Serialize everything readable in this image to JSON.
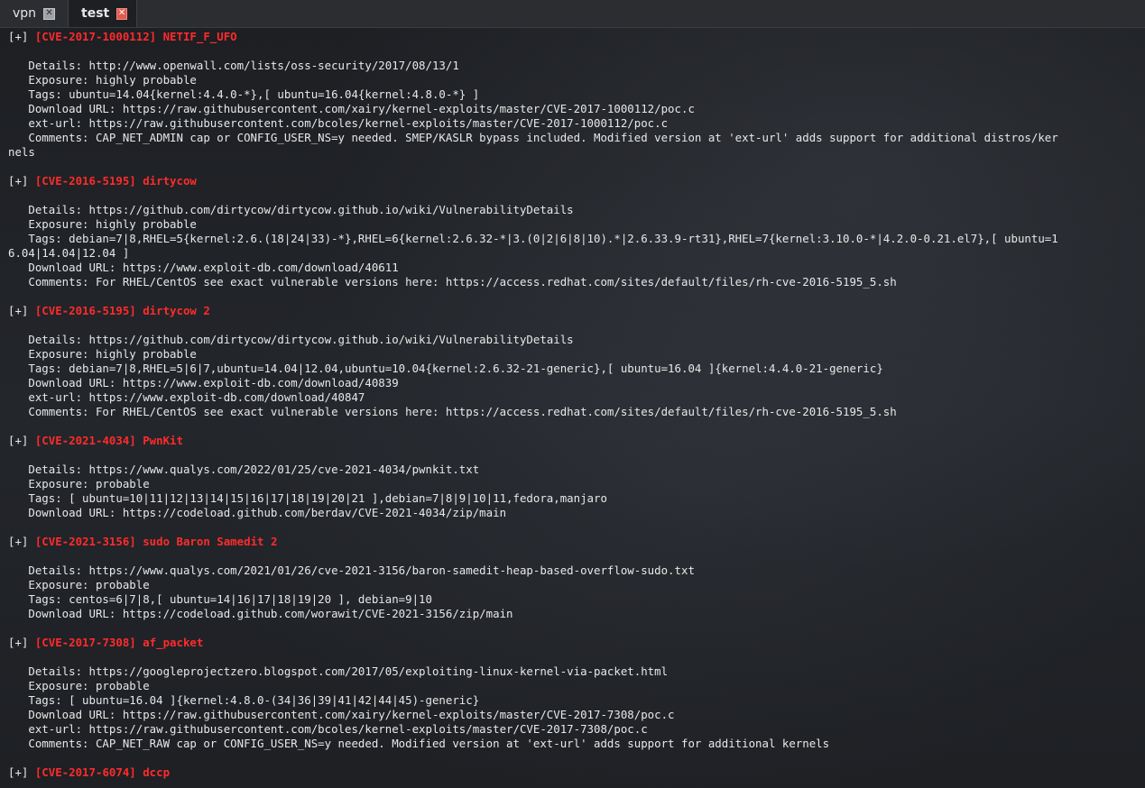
{
  "tabs": [
    {
      "label": "vpn",
      "active": false
    },
    {
      "label": "test",
      "active": true
    }
  ],
  "entries": [
    {
      "marker": "[+] ",
      "cve": "[CVE-2017-1000112]",
      "name": " NETIF_F_UFO",
      "lines": [
        "   Details: http://www.openwall.com/lists/oss-security/2017/08/13/1",
        "   Exposure: highly probable",
        "   Tags: ubuntu=14.04{kernel:4.4.0-*},[ ubuntu=16.04{kernel:4.8.0-*} ]",
        "   Download URL: https://raw.githubusercontent.com/xairy/kernel-exploits/master/CVE-2017-1000112/poc.c",
        "   ext-url: https://raw.githubusercontent.com/bcoles/kernel-exploits/master/CVE-2017-1000112/poc.c",
        "   Comments: CAP_NET_ADMIN cap or CONFIG_USER_NS=y needed. SMEP/KASLR bypass included. Modified version at 'ext-url' adds support for additional distros/ker",
        "nels"
      ]
    },
    {
      "marker": "[+] ",
      "cve": "[CVE-2016-5195]",
      "name": " dirtycow",
      "lines": [
        "   Details: https://github.com/dirtycow/dirtycow.github.io/wiki/VulnerabilityDetails",
        "   Exposure: highly probable",
        "   Tags: debian=7|8,RHEL=5{kernel:2.6.(18|24|33)-*},RHEL=6{kernel:2.6.32-*|3.(0|2|6|8|10).*|2.6.33.9-rt31},RHEL=7{kernel:3.10.0-*|4.2.0-0.21.el7},[ ubuntu=1",
        "6.04|14.04|12.04 ]",
        "   Download URL: https://www.exploit-db.com/download/40611",
        "   Comments: For RHEL/CentOS see exact vulnerable versions here: https://access.redhat.com/sites/default/files/rh-cve-2016-5195_5.sh"
      ]
    },
    {
      "marker": "[+] ",
      "cve": "[CVE-2016-5195]",
      "name": " dirtycow 2",
      "lines": [
        "   Details: https://github.com/dirtycow/dirtycow.github.io/wiki/VulnerabilityDetails",
        "   Exposure: highly probable",
        "   Tags: debian=7|8,RHEL=5|6|7,ubuntu=14.04|12.04,ubuntu=10.04{kernel:2.6.32-21-generic},[ ubuntu=16.04 ]{kernel:4.4.0-21-generic}",
        "   Download URL: https://www.exploit-db.com/download/40839",
        "   ext-url: https://www.exploit-db.com/download/40847",
        "   Comments: For RHEL/CentOS see exact vulnerable versions here: https://access.redhat.com/sites/default/files/rh-cve-2016-5195_5.sh"
      ]
    },
    {
      "marker": "[+] ",
      "cve": "[CVE-2021-4034]",
      "name": " PwnKit",
      "lines": [
        "   Details: https://www.qualys.com/2022/01/25/cve-2021-4034/pwnkit.txt",
        "   Exposure: probable",
        "   Tags: [ ubuntu=10|11|12|13|14|15|16|17|18|19|20|21 ],debian=7|8|9|10|11,fedora,manjaro",
        "   Download URL: https://codeload.github.com/berdav/CVE-2021-4034/zip/main"
      ]
    },
    {
      "marker": "[+] ",
      "cve": "[CVE-2021-3156]",
      "name": " sudo Baron Samedit 2",
      "lines": [
        "   Details: https://www.qualys.com/2021/01/26/cve-2021-3156/baron-samedit-heap-based-overflow-sudo.txt",
        "   Exposure: probable",
        "   Tags: centos=6|7|8,[ ubuntu=14|16|17|18|19|20 ], debian=9|10",
        "   Download URL: https://codeload.github.com/worawit/CVE-2021-3156/zip/main"
      ]
    },
    {
      "marker": "[+] ",
      "cve": "[CVE-2017-7308]",
      "name": " af_packet",
      "lines": [
        "   Details: https://googleprojectzero.blogspot.com/2017/05/exploiting-linux-kernel-via-packet.html",
        "   Exposure: probable",
        "   Tags: [ ubuntu=16.04 ]{kernel:4.8.0-(34|36|39|41|42|44|45)-generic}",
        "   Download URL: https://raw.githubusercontent.com/xairy/kernel-exploits/master/CVE-2017-7308/poc.c",
        "   ext-url: https://raw.githubusercontent.com/bcoles/kernel-exploits/master/CVE-2017-7308/poc.c",
        "   Comments: CAP_NET_RAW cap or CONFIG_USER_NS=y needed. Modified version at 'ext-url' adds support for additional kernels"
      ]
    },
    {
      "marker": "[+] ",
      "cve": "[CVE-2017-6074]",
      "name": " dccp",
      "lines": []
    }
  ]
}
